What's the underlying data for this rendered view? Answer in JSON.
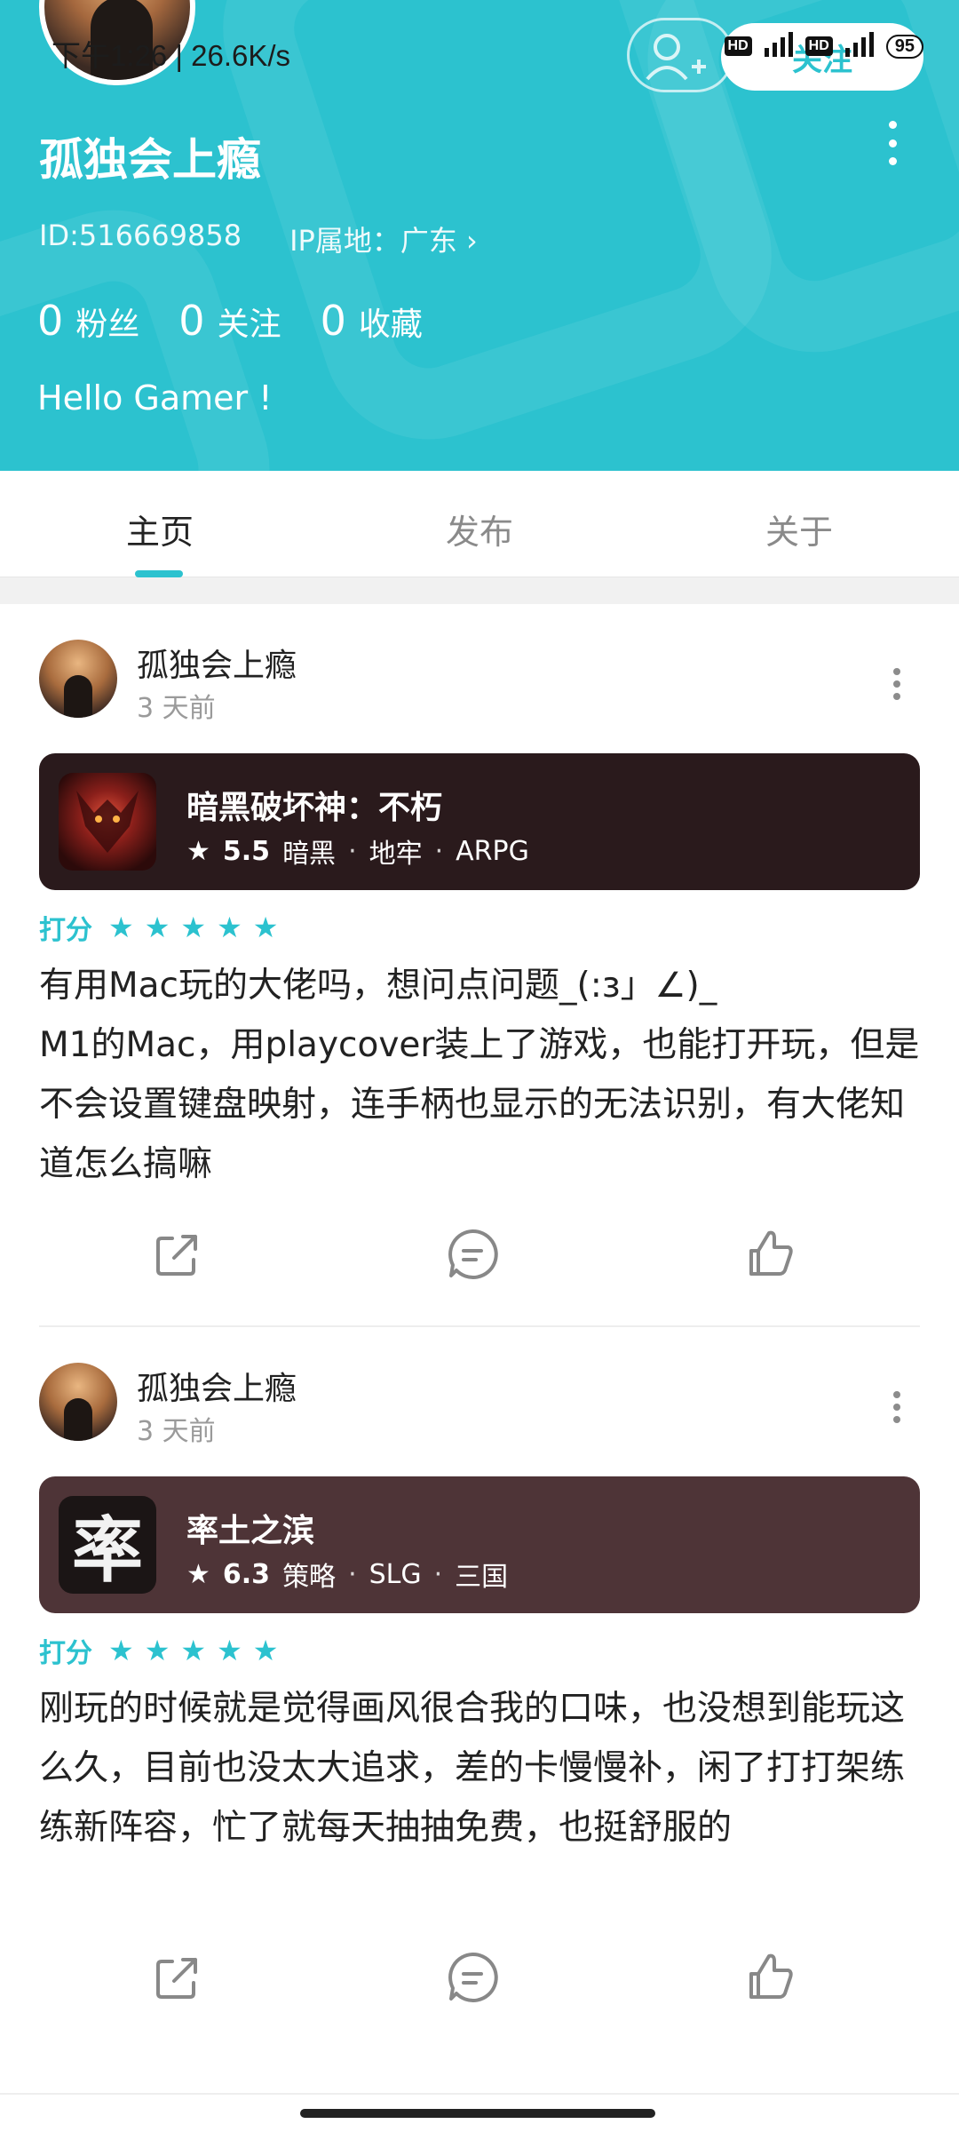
{
  "status_bar": {
    "time_speed": "下午1:26 | 26.6K/s",
    "network_5g": "5G",
    "network_4g": "4G",
    "hd": "HD",
    "battery": "95"
  },
  "profile": {
    "follow_label": "关注",
    "name": "孤独会上瘾",
    "id": "ID:516669858",
    "ip_location": "IP属地：广东 ›",
    "followers_count": "0",
    "followers_label": "粉丝",
    "following_count": "0",
    "following_label": "关注",
    "favorites_count": "0",
    "favorites_label": "收藏",
    "bio": "Hello Gamer !"
  },
  "tabs": [
    {
      "label": "主页",
      "active": true
    },
    {
      "label": "发布",
      "active": false
    },
    {
      "label": "关于",
      "active": false
    }
  ],
  "posts": [
    {
      "author": "孤独会上瘾",
      "time": "3 天前",
      "game": {
        "title": "暗黑破坏神：不朽",
        "score": "5.5",
        "tags": [
          "暗黑",
          "地牢",
          "ARPG"
        ],
        "card_color": "#2a1a1c"
      },
      "rating_label": "打分",
      "stars": 5,
      "content": "有用Mac玩的大佬吗，想问点问题_(:з」∠)_\nM1的Mac，用playcover装上了游戏，也能打开玩，但是不会设置键盘映射，连手柄也显示的无法识别，有大佬知道怎么搞嘛"
    },
    {
      "author": "孤独会上瘾",
      "time": "3 天前",
      "game": {
        "title": "率土之滨",
        "score": "6.3",
        "tags": [
          "策略",
          "SLG",
          "三国"
        ],
        "card_color": "#4e3437",
        "icon_text": "率"
      },
      "rating_label": "打分",
      "stars": 5,
      "content": "刚玩的时候就是觉得画风很合我的口味，也没想到能玩这么久，目前也没太大追求，差的卡慢慢补，闲了打打架练练新阵容，忙了就每天抽抽免费，也挺舒服的"
    }
  ],
  "colors": {
    "accent": "#2cc2cf",
    "header_bg": "#2cc2cf"
  }
}
